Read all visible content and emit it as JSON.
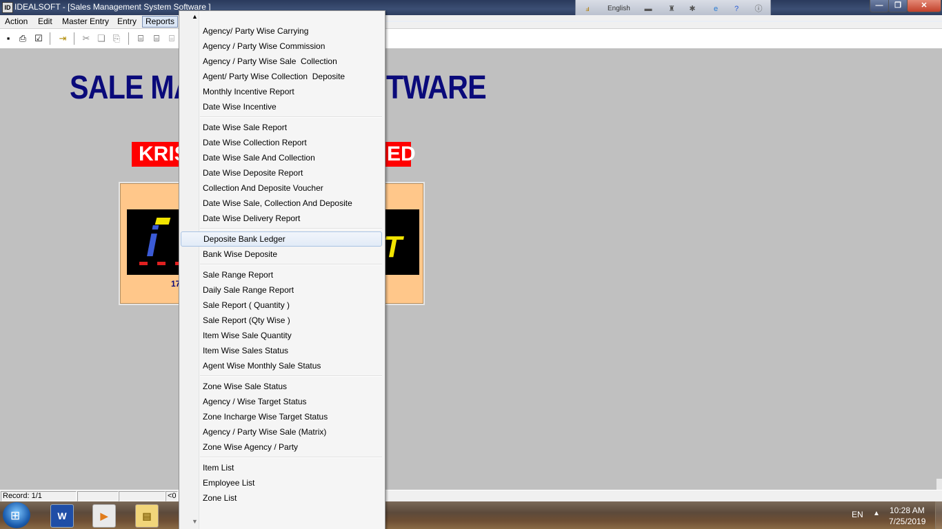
{
  "window": {
    "title": "IDEALSOFT - [Sales Management System Software  ]",
    "language": "English"
  },
  "menubar": [
    "Action",
    "Edit",
    "Master Entry",
    "Entry",
    "Reports"
  ],
  "content": {
    "heading_left": "SALE MA",
    "heading_right": "TWARE",
    "company_left": "KRIS",
    "company_right": "ED",
    "logo_phone": "17"
  },
  "status": {
    "record": "Record: 1/1",
    "nav": "<0"
  },
  "taskbar": {
    "lang": "EN",
    "time": "10:28 AM",
    "date": "7/25/2019"
  },
  "reports_menu": {
    "groups": [
      [
        "Agency/ Party Wise Carrying",
        "Agency / Party Wise Commission",
        "Agency / Party Wise Sale  Collection",
        "Agent/ Party Wise Collection  Deposite",
        "Monthly Incentive Report",
        "Date Wise Incentive"
      ],
      [
        "Date Wise Sale Report",
        "Date Wise Collection Report",
        "Date Wise Sale And Collection",
        "Date Wise Deposite Report",
        "Collection And Deposite Voucher",
        "Date Wise Sale, Collection And Deposite",
        "Date Wise Delivery Report"
      ],
      [
        "Deposite Bank Ledger",
        "Bank Wise Deposite"
      ],
      [
        "Sale Range Report",
        "Daily Sale Range Report",
        "Sale Report ( Quantity )",
        "Sale Report (Qty Wise )",
        "Item Wise Sale Quantity",
        "Item Wise Sales Status",
        "Agent Wise Monthly Sale Status"
      ],
      [
        "Zone Wise Sale Status",
        "Agency / Wise Target Status",
        "Zone Incharge Wise Target Status",
        "Agency / Party Wise Sale (Matrix)",
        "Zone Wise Agency / Party"
      ],
      [
        "Item List",
        "Employee List",
        "Zone List"
      ]
    ],
    "highlighted": "Deposite Bank Ledger"
  },
  "colors": {
    "heading": "#0a0a7a",
    "company_bg": "#ff0000",
    "logo_panel": "#ffc78a"
  }
}
